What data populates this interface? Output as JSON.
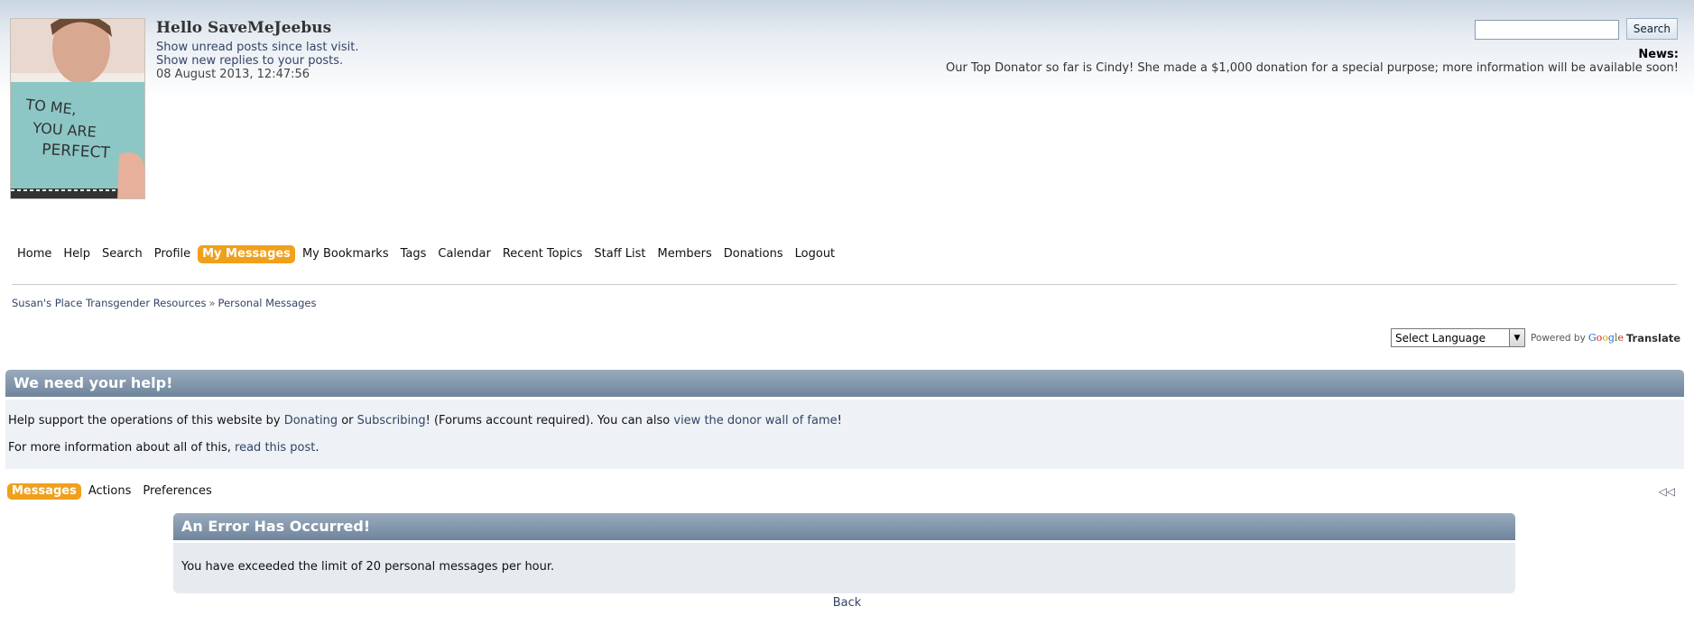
{
  "user": {
    "greeting": "Hello SaveMeJeebus",
    "unread_link": "Show unread posts since last visit.",
    "replies_link": "Show new replies to your posts.",
    "datetime": "08 August 2013, 12:47:56",
    "avatar_sign_text": [
      "TO ME,",
      "YOU ARE",
      "PERFECT"
    ]
  },
  "search": {
    "value": "",
    "button_label": "Search"
  },
  "news": {
    "title": "News:",
    "text": "Our Top Donator so far is Cindy! She made a $1,000 donation for a special purpose; more information will be available soon!"
  },
  "nav": {
    "items": [
      {
        "label": "Home",
        "active": false
      },
      {
        "label": "Help",
        "active": false
      },
      {
        "label": "Search",
        "active": false
      },
      {
        "label": "Profile",
        "active": false
      },
      {
        "label": "My Messages",
        "active": true
      },
      {
        "label": "My Bookmarks",
        "active": false
      },
      {
        "label": "Tags",
        "active": false
      },
      {
        "label": "Calendar",
        "active": false
      },
      {
        "label": "Recent Topics",
        "active": false
      },
      {
        "label": "Staff List",
        "active": false
      },
      {
        "label": "Members",
        "active": false
      },
      {
        "label": "Donations",
        "active": false
      },
      {
        "label": "Logout",
        "active": false
      }
    ],
    "active_color": "#f0a01c"
  },
  "breadcrumb": {
    "home": "Susan's Place Transgender Resources",
    "separator": "»",
    "current": "Personal Messages"
  },
  "translate": {
    "selected": "Select Language",
    "powered_by": "Powered by",
    "google": [
      "G",
      "o",
      "o",
      "g",
      "l",
      "e"
    ],
    "word": "Translate"
  },
  "help": {
    "title": "We need your help!",
    "line1_pre": "Help support the operations of this website by ",
    "donating": "Donating",
    "or": " or ",
    "subscribing": "Subscribing",
    "line1_mid": "! (Forums account required). You can also ",
    "donor_wall": "view the donor wall of fame",
    "line1_end": "!",
    "line2_pre": "For more information about all of this, ",
    "read_post": "read this post",
    "line2_end": "."
  },
  "pm_tabs": [
    {
      "label": "Messages",
      "active": true
    },
    {
      "label": "Actions",
      "active": false
    },
    {
      "label": "Preferences",
      "active": false
    }
  ],
  "collapse_glyph": "◁◁",
  "error": {
    "title": "An Error Has Occurred!",
    "message": "You have exceeded the limit of 20 personal messages per hour.",
    "back_label": "Back"
  },
  "colors": {
    "header_bar": "#6f859c",
    "link": "#334466",
    "accent": "#f0a01c"
  }
}
